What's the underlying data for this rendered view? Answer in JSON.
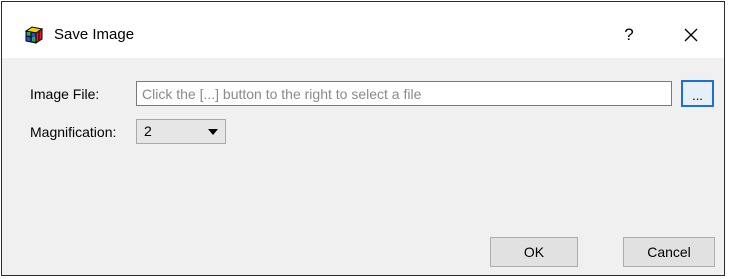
{
  "window": {
    "title": "Save Image",
    "help_label": "?"
  },
  "form": {
    "image_file_label": "Image File:",
    "image_file_value": "",
    "image_file_placeholder": "Click the [...] button to the right to select a file",
    "browse_label": "...",
    "magnification_label": "Magnification:",
    "magnification_value": "2"
  },
  "buttons": {
    "ok_label": "OK",
    "cancel_label": "Cancel"
  },
  "icons": {
    "app": "colorful-cube-icon",
    "close": "close-icon",
    "dropdown": "chevron-down-icon"
  },
  "colors": {
    "focus_border": "#1c6fd6"
  }
}
